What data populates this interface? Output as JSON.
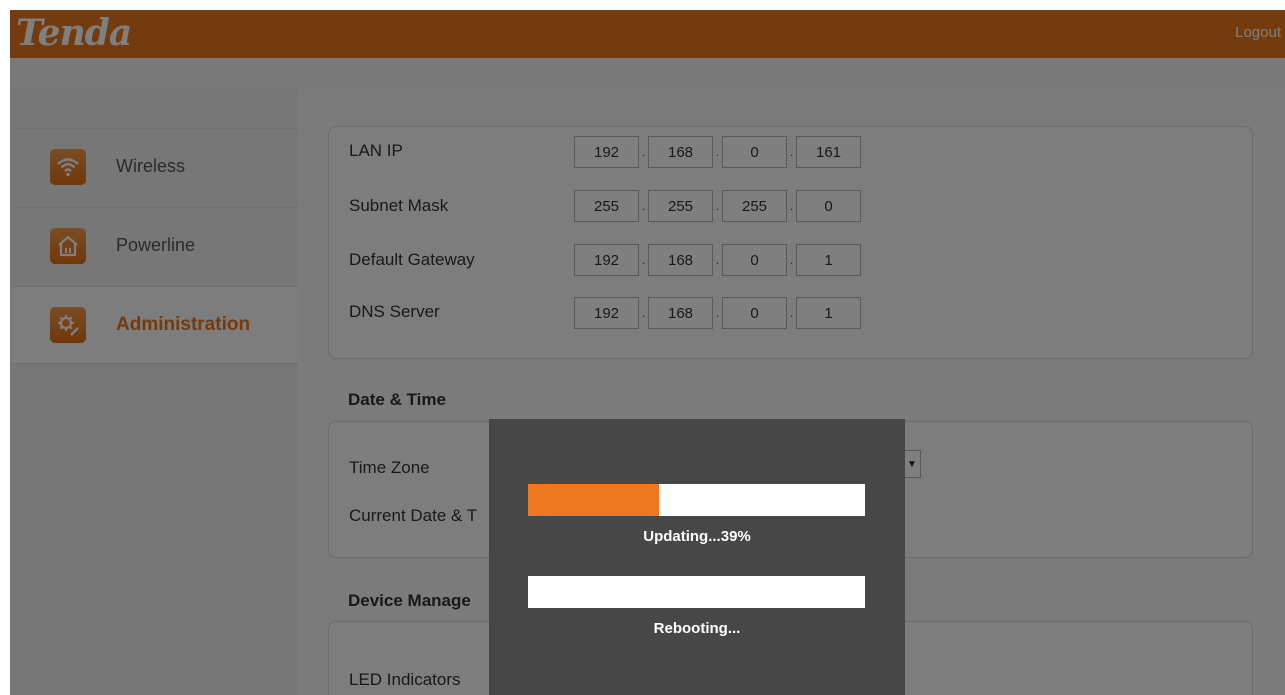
{
  "header": {
    "logo_text": "Tenda",
    "logout_label": "Logout"
  },
  "sidebar": {
    "items": [
      {
        "label": "Wireless",
        "icon": "wifi-icon",
        "active": false
      },
      {
        "label": "Powerline",
        "icon": "house-icon",
        "active": false
      },
      {
        "label": "Administration",
        "icon": "gear-icon",
        "active": true
      }
    ]
  },
  "lan": {
    "rows": [
      {
        "label": "LAN IP",
        "octets": [
          "192",
          "168",
          "0",
          "161"
        ]
      },
      {
        "label": "Subnet Mask",
        "octets": [
          "255",
          "255",
          "255",
          "0"
        ]
      },
      {
        "label": "Default Gateway",
        "octets": [
          "192",
          "168",
          "0",
          "1"
        ]
      },
      {
        "label": "DNS Server",
        "octets": [
          "192",
          "168",
          "0",
          "1"
        ]
      }
    ]
  },
  "datetime": {
    "title": "Date & Time",
    "time_zone_label": "Time Zone",
    "current_label": "Current Date & T"
  },
  "device": {
    "title": "Device Manage",
    "led_label": "LED Indicators"
  },
  "modal": {
    "update_progress": 0.39,
    "update_text": "Updating...39%",
    "reboot_progress": 0,
    "reboot_text": "Rebooting..."
  },
  "colors": {
    "accent": "#e8781c",
    "progress_fill": "#ee7722",
    "modal_bg": "#474747"
  }
}
